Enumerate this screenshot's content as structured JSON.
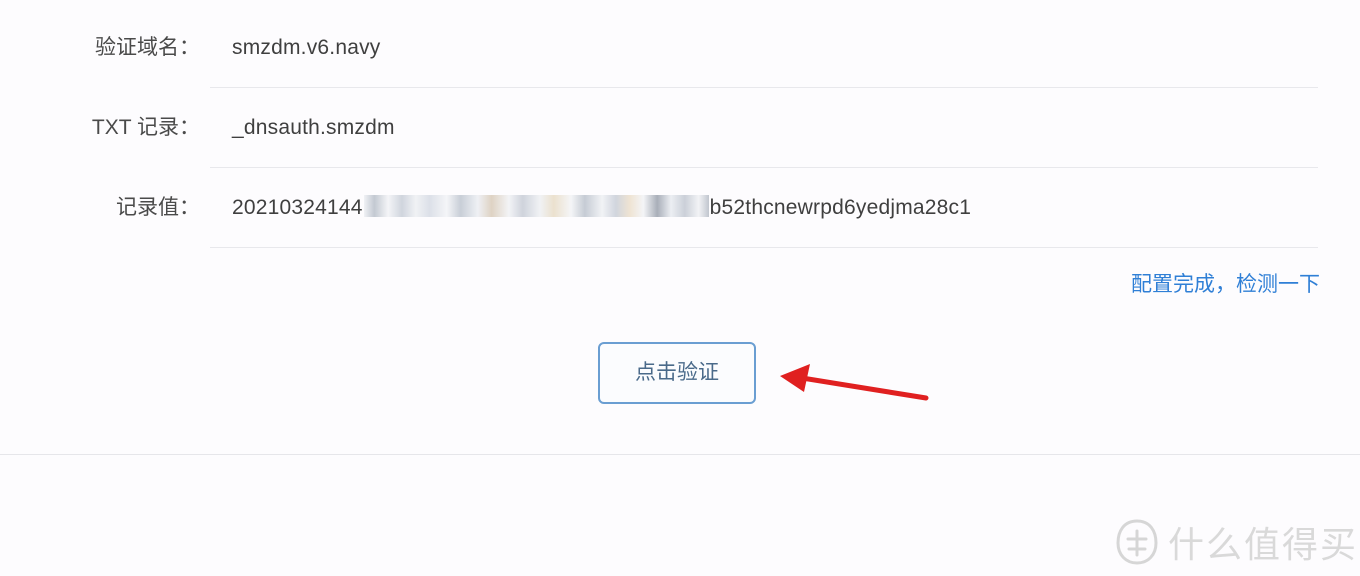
{
  "records": [
    {
      "label": "验证域名：",
      "value": "smzdm.v6.navy"
    },
    {
      "label": "TXT 记录：",
      "value": "_dnsauth.smzdm"
    },
    {
      "label": "记录值：",
      "value_prefix": "20210324144",
      "value_suffix": "b52thcnewrpd6yedjma28c1"
    }
  ],
  "check_link": "配置完成，检测一下",
  "verify_button": "点击验证",
  "watermark": {
    "text": "什么值得买",
    "icon": "smzdm-logo-icon"
  },
  "colors": {
    "link": "#2f7fd6",
    "button_border": "#6a9ed2",
    "arrow": "#e02020"
  }
}
